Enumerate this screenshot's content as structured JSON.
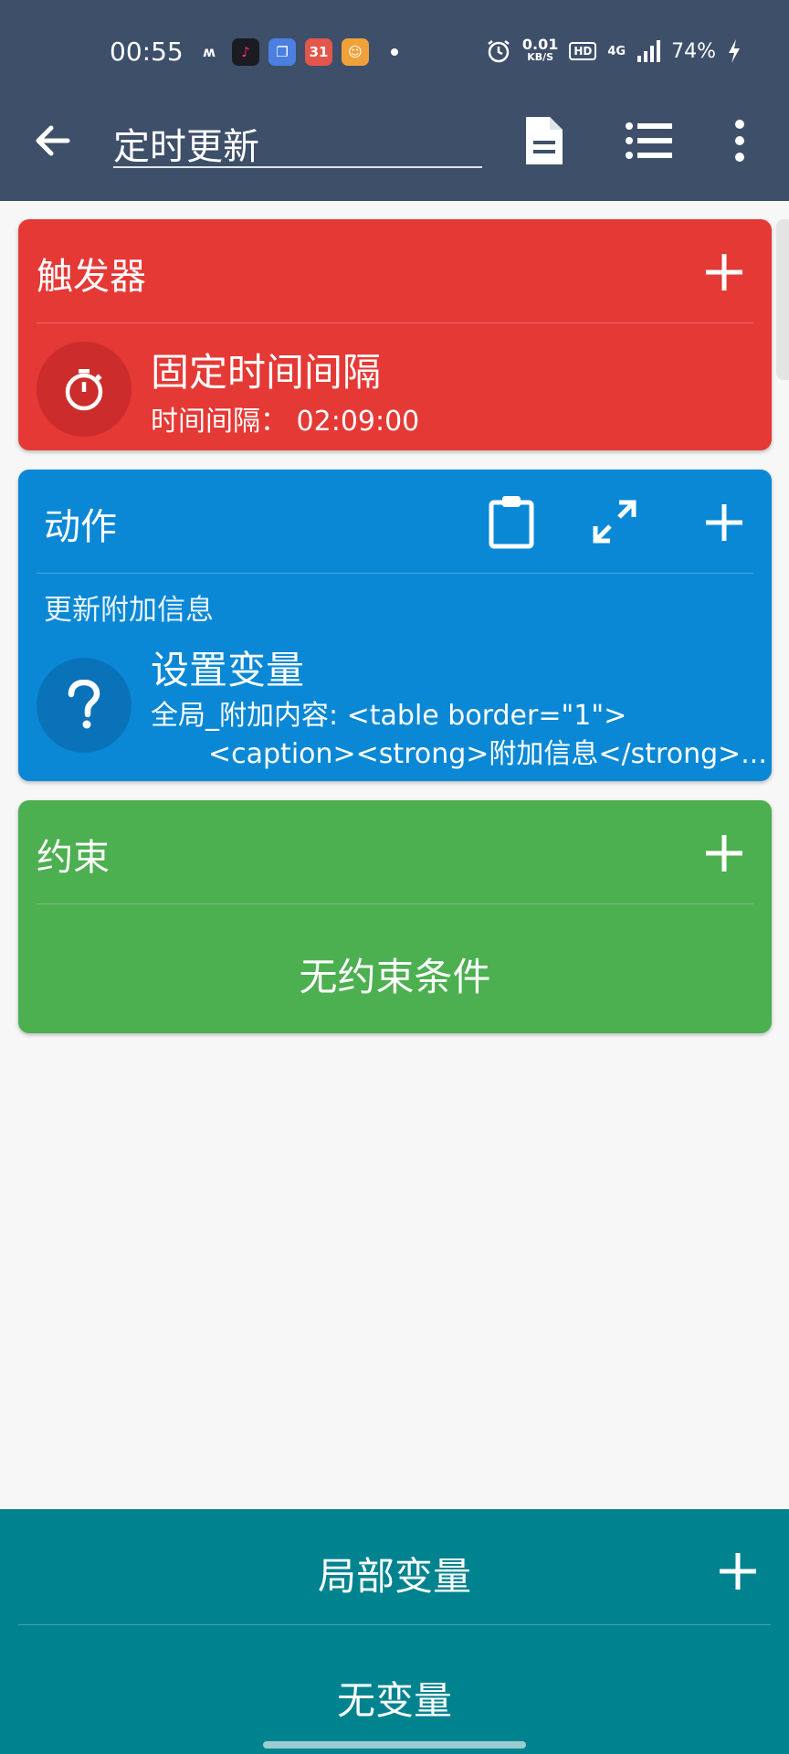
{
  "status_bar": {
    "time": "00:55",
    "speed_value": "0.01",
    "speed_unit": "KB/S",
    "hd": "HD",
    "network": "4G",
    "battery": "74%"
  },
  "app_bar": {
    "title": "定时更新"
  },
  "trigger": {
    "title": "触发器",
    "item_name": "固定时间间隔",
    "item_detail": "时间间隔：  02:09:00"
  },
  "action": {
    "title": "动作",
    "group_name": "更新附加信息",
    "item_name": "设置变量",
    "detail_line1": "全局_附加内容: <table border=\"1\">",
    "detail_line2": "<caption><strong>附加信息</strong>..."
  },
  "constraint": {
    "title": "约束",
    "empty_text": "无约束条件"
  },
  "local_vars": {
    "title": "局部变量",
    "empty_text": "无变量"
  },
  "colors": {
    "appbar": "#3e4f6a",
    "trigger": "#e53935",
    "action": "#0a88d5",
    "constraint": "#4caf50",
    "local_vars": "#00838f"
  }
}
